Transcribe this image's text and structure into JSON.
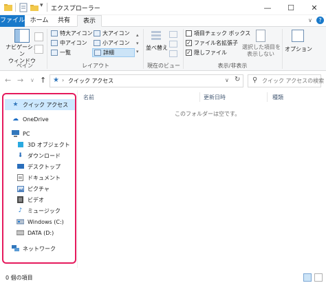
{
  "window": {
    "title": "エクスプローラー",
    "minimize": "—",
    "maximize": "☐",
    "close": "✕"
  },
  "tabs": [
    {
      "label": "ファイル"
    },
    {
      "label": "ホーム"
    },
    {
      "label": "共有"
    },
    {
      "label": "表示"
    }
  ],
  "ribbon": {
    "pane": {
      "nav_pane_label_1": "ナビゲーション",
      "nav_pane_label_2": "ウィンドウ",
      "group_label": "ペイン"
    },
    "layout": {
      "items": [
        "特大アイコン",
        "大アイコン",
        "中アイコン",
        "小アイコン",
        "一覧",
        "詳細"
      ],
      "group_label": "レイアウト"
    },
    "current_view": {
      "sort_label": "並べ替え",
      "group_label": "現在のビュー"
    },
    "show_hide": {
      "item_checkboxes": "項目チェック ボックス",
      "file_extensions": "ファイル名拡張子",
      "hidden_files": "隠しファイル",
      "hide_selected_1": "選択した項目を",
      "hide_selected_2": "表示しない",
      "group_label": "表示/非表示",
      "item_checkboxes_checked": false,
      "file_extensions_checked": true,
      "hidden_files_checked": true
    },
    "options": {
      "label": "オプション"
    }
  },
  "nav": {
    "address": "クイック アクセス",
    "search_placeholder": "クイック アクセスの検索"
  },
  "sidebar": {
    "items": [
      {
        "label": "クイック アクセス",
        "icon": "star-icon",
        "color": "#3277bc"
      },
      {
        "label": "OneDrive",
        "icon": "cloud-icon",
        "color": "#1e6fc6"
      },
      {
        "label": "PC",
        "icon": "computer-icon",
        "color": "#3277bc"
      },
      {
        "label": "3D オブジェクト",
        "icon": "cube-icon",
        "color": "#2aa9e0"
      },
      {
        "label": "ダウンロード",
        "icon": "download-icon",
        "color": "#2a6ebb"
      },
      {
        "label": "デスクトップ",
        "icon": "desktop-icon",
        "color": "#2a6ebb"
      },
      {
        "label": "ドキュメント",
        "icon": "document-icon",
        "color": "#7a7a7a"
      },
      {
        "label": "ピクチャ",
        "icon": "picture-icon",
        "color": "#4f81bd"
      },
      {
        "label": "ビデオ",
        "icon": "video-icon",
        "color": "#4a4a4a"
      },
      {
        "label": "ミュージック",
        "icon": "music-icon",
        "color": "#1e7bd2"
      },
      {
        "label": "Windows (C:)",
        "icon": "drive-icon",
        "color": "#5b7da6"
      },
      {
        "label": "DATA (D:)",
        "icon": "drive-icon",
        "color": "#6c6c6c"
      },
      {
        "label": "ネットワーク",
        "icon": "network-icon",
        "color": "#3277bc"
      }
    ]
  },
  "content": {
    "columns": [
      "名前",
      "更新日時",
      "種類"
    ],
    "empty_message": "このフォルダーは空です。"
  },
  "status": {
    "item_count": "0 個の項目"
  },
  "colors": {
    "accent": "#1979ca",
    "highlight": "#e5195c"
  }
}
